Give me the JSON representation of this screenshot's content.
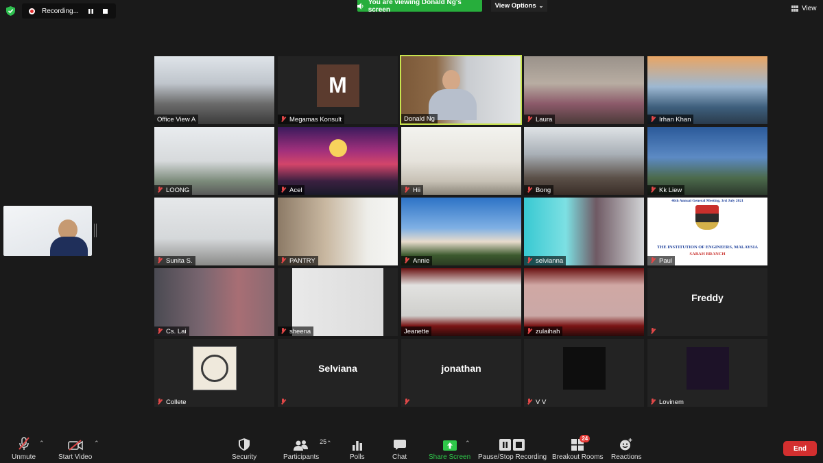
{
  "recording": {
    "label": "Recording..."
  },
  "banner": {
    "viewing": "You are viewing Donald Ng's screen",
    "view_options": "View Options"
  },
  "view_label": "View",
  "tiles": [
    {
      "name": "Office View A"
    },
    {
      "name": "Megamas Konsult",
      "initial": "M"
    },
    {
      "name": "Donald Ng"
    },
    {
      "name": "Laura"
    },
    {
      "name": "Irhan Khan"
    },
    {
      "name": "LOONG"
    },
    {
      "name": "Acel"
    },
    {
      "name": "Hii"
    },
    {
      "name": "Bong"
    },
    {
      "name": "Kk Liew"
    },
    {
      "name": "Sunita S."
    },
    {
      "name": "PANTRY"
    },
    {
      "name": "Annie"
    },
    {
      "name": "selvianna"
    },
    {
      "name": "Paul",
      "banner_line1": "46th Annual General Meeting, 3rd July 2021",
      "banner_line2": "THE INSTITUTION OF ENGINEERS, MALAYSIA",
      "banner_line3": "SABAH BRANCH"
    },
    {
      "name": "Cs. Lai"
    },
    {
      "name": "sheena"
    },
    {
      "name": "Jeanette"
    },
    {
      "name": "zulaihah"
    },
    {
      "name": "",
      "center_name": "Freddy"
    },
    {
      "name": "Collete"
    },
    {
      "name": "",
      "center_name": "Selviana"
    },
    {
      "name": "",
      "center_name": "jonathan"
    },
    {
      "name": "V V"
    },
    {
      "name": "Lovinem"
    }
  ],
  "toolbar": {
    "unmute": "Unmute",
    "start_video": "Start Video",
    "security": "Security",
    "participants": "Participants",
    "participants_count": "25",
    "polls": "Polls",
    "chat": "Chat",
    "share_screen": "Share Screen",
    "pause_recording": "Pause/Stop Recording",
    "breakout_rooms": "Breakout Rooms",
    "breakout_count": "24",
    "reactions": "Reactions",
    "end": "End"
  },
  "colors": {
    "accent_green": "#27ae3c",
    "active_speaker": "#c8e34e",
    "end_red": "#d32f2f",
    "muted_red": "#e14848"
  }
}
